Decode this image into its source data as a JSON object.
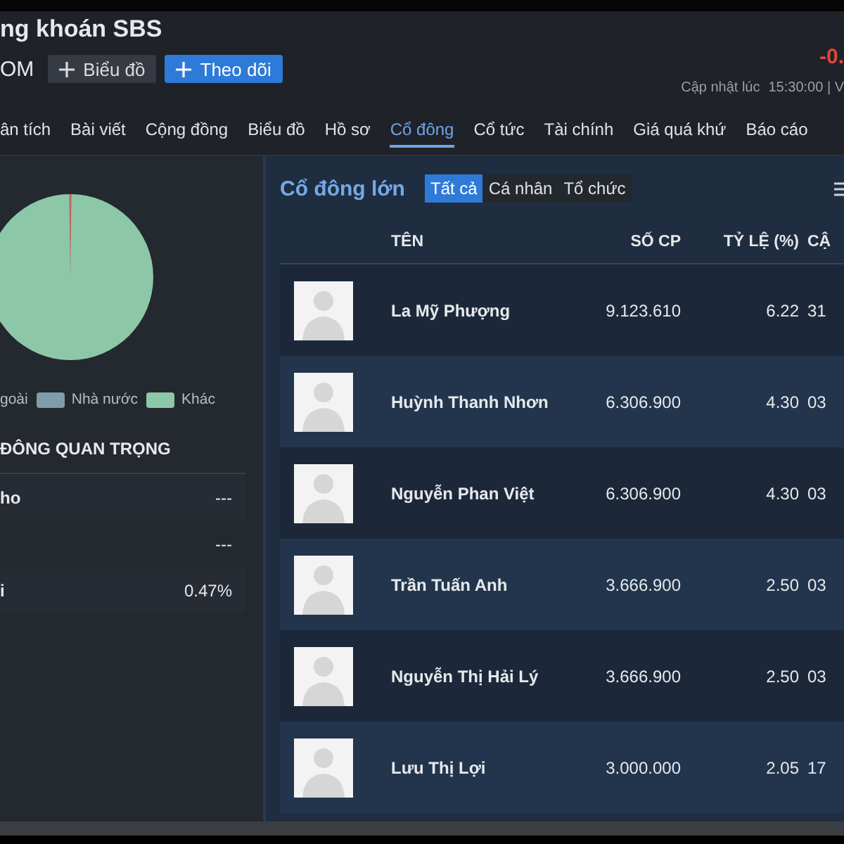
{
  "header": {
    "title": "ng khoán SBS",
    "exchange": "OM",
    "buttons": [
      {
        "label": "Biểu đồ",
        "kind": "plain"
      },
      {
        "label": "Theo dõi",
        "kind": "primary"
      }
    ],
    "change": "-0.",
    "updated_label": "Cập nhật lúc",
    "updated_time": "15:30:00 | V"
  },
  "tabs": [
    {
      "label": "ân tích",
      "selected": false
    },
    {
      "label": "Bài viết",
      "selected": false
    },
    {
      "label": "Cộng đồng",
      "selected": false
    },
    {
      "label": "Biểu đồ",
      "selected": false
    },
    {
      "label": "Hồ sơ",
      "selected": false
    },
    {
      "label": "Cổ đông",
      "selected": true
    },
    {
      "label": "Cổ tức",
      "selected": false
    },
    {
      "label": "Tài chính",
      "selected": false
    },
    {
      "label": "Giá quá khứ",
      "selected": false
    },
    {
      "label": "Báo cáo",
      "selected": false
    }
  ],
  "ownership": {
    "legend": [
      {
        "label": "goài"
      },
      {
        "label": "Nhà nước",
        "color": "#7f9da8"
      },
      {
        "label": "Khác",
        "color": "#8cc7a8"
      }
    ],
    "section_title": "ĐÔNG QUAN TRỌNG",
    "rows": [
      {
        "label": "ho",
        "value": "---"
      },
      {
        "value": "---"
      },
      {
        "label": "i",
        "value": "0.47%"
      }
    ]
  },
  "shareholders": {
    "title": "Cổ đông lớn",
    "filters": [
      {
        "label": "Tất cả",
        "selected": true
      },
      {
        "label": "Cá nhân",
        "selected": false
      },
      {
        "label": "Tổ chức",
        "selected": false
      }
    ],
    "columns": [
      "TÊN",
      "SỐ CP",
      "TỶ LỆ (%)",
      "CẬ"
    ],
    "rows": [
      {
        "name": "La Mỹ Phượng",
        "shares": "9.123.610",
        "ratio": "6.22",
        "column_4": "31"
      },
      {
        "name": "Huỳnh Thanh Nhơn",
        "shares": "6.306.900",
        "ratio": "4.30",
        "column_4": "03"
      },
      {
        "name": "Nguyễn Phan Việt",
        "shares": "6.306.900",
        "ratio": "4.30",
        "column_4": "03"
      },
      {
        "name": "Trần Tuấn Anh",
        "shares": "3.666.900",
        "ratio": "2.50",
        "column_4": "03"
      },
      {
        "name": "Nguyễn Thị Hải Lý",
        "shares": "3.666.900",
        "ratio": "2.50",
        "column_4": "03"
      },
      {
        "name": "Lưu Thị Lợi",
        "shares": "3.000.000",
        "ratio": "2.05",
        "column_4": "17"
      }
    ]
  }
}
